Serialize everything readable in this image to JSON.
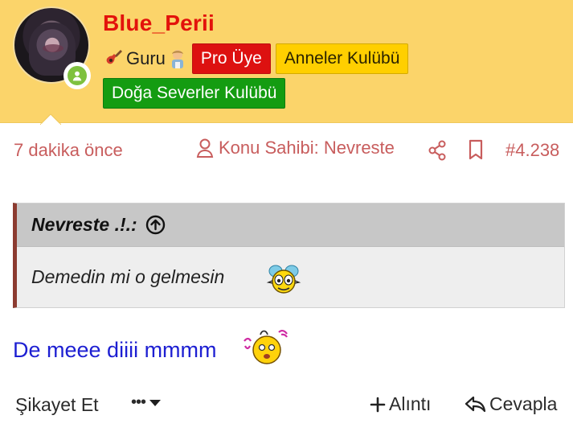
{
  "user": {
    "name": "Blue_Perii",
    "rank": "Guru",
    "tags": [
      "Pro Üye",
      "Anneler Kulübü"
    ],
    "club": "Doğa Severler Kulübü"
  },
  "meta": {
    "time": "7 dakika önce",
    "owner": "Konu Sahibi: Nevreste",
    "post_number": "#4.238"
  },
  "quote": {
    "author": "Nevreste .!.:",
    "text": "Demedin mi o gelmesin"
  },
  "message": {
    "text": "De meee diiii mmmm"
  },
  "actions": {
    "report": "Şikayet Et",
    "more": "•••",
    "quote": "Alıntı",
    "reply": "Cevapla"
  },
  "icons": {
    "online": "person-icon",
    "owner": "user-outline-icon",
    "share": "share-icon",
    "bookmark": "bookmark-icon",
    "up": "arrow-up-circle-icon",
    "more_caret": "caret-down-icon",
    "plus": "plus-icon",
    "reply": "reply-icon"
  },
  "colors": {
    "header": "#fbd46a",
    "username": "#e3120b",
    "meta": "#c85d5d",
    "message": "#1d1fd2",
    "quote_border": "#8c3b30"
  }
}
